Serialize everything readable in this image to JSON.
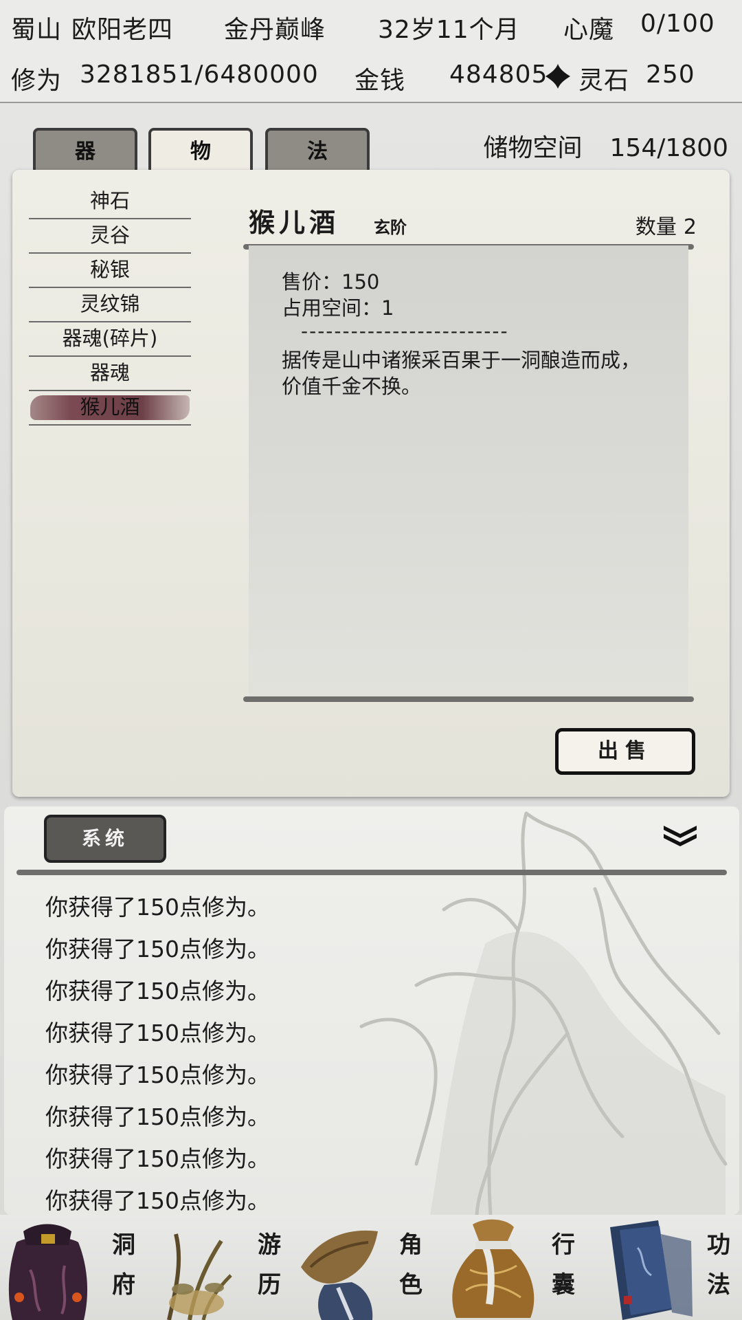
{
  "status": {
    "sect": "蜀山",
    "name": "欧阳老四",
    "realm": "金丹巅峰",
    "age": "32岁11个月",
    "demon_label": "心魔",
    "demon_value": "0/100",
    "cultivation_label": "修为",
    "cultivation_value": "3281851/6480000",
    "money_label": "金钱",
    "money_value": "484805",
    "spirit_stone_label": "灵石",
    "spirit_stone_value": "250"
  },
  "tabs": [
    {
      "label": "器"
    },
    {
      "label": "物"
    },
    {
      "label": "法"
    }
  ],
  "active_tab": "物",
  "storage": {
    "label": "储物空间",
    "value": "154/1800"
  },
  "items": [
    {
      "label": "神石"
    },
    {
      "label": "灵谷"
    },
    {
      "label": "秘银"
    },
    {
      "label": "灵纹锦"
    },
    {
      "label": "器魂(碎片)"
    },
    {
      "label": "器魂"
    },
    {
      "label": "猴儿酒"
    }
  ],
  "selected_item": "猴儿酒",
  "detail": {
    "name": "猴儿酒",
    "grade": "玄阶",
    "quantity_label": "数量",
    "quantity": "2",
    "price_line": "售价：150",
    "space_line": "占用空间：1",
    "separator": "-------------------------",
    "desc_line1": "据传是山中诸猴采百果于一洞酿造而成，",
    "desc_line2": "价值千金不换。",
    "sell_label": "出售"
  },
  "log": {
    "tab_label": "系统",
    "entries": [
      "你获得了150点修为。",
      "你获得了150点修为。",
      "你获得了150点修为。",
      "你获得了150点修为。",
      "你获得了150点修为。",
      "你获得了150点修为。",
      "你获得了150点修为。",
      "你获得了150点修为。"
    ]
  },
  "nav": [
    {
      "top": "洞",
      "bottom": "府",
      "icon": "cave-mansion-icon"
    },
    {
      "top": "游",
      "bottom": "历",
      "icon": "travel-icon"
    },
    {
      "top": "角",
      "bottom": "色",
      "icon": "character-icon"
    },
    {
      "top": "行",
      "bottom": "囊",
      "icon": "bag-icon"
    },
    {
      "top": "功",
      "bottom": "法",
      "icon": "technique-book-icon"
    }
  ]
}
